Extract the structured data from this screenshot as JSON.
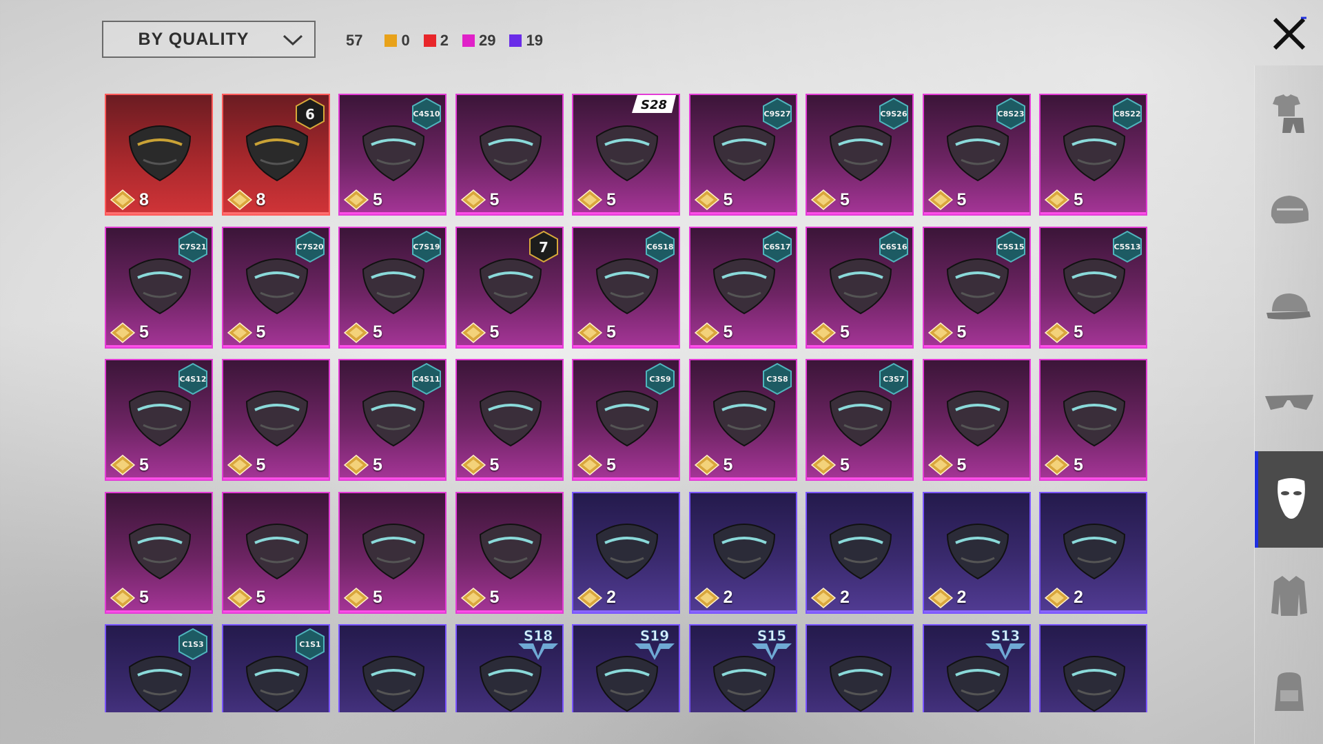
{
  "sort": {
    "label": "BY QUALITY"
  },
  "counts": {
    "total": "57",
    "items": [
      {
        "color": "#e8a21a",
        "value": "0"
      },
      {
        "color": "#e8262a",
        "value": "2"
      },
      {
        "color": "#e021c8",
        "value": "29"
      },
      {
        "color": "#6a2ce8",
        "value": "19"
      }
    ]
  },
  "sidebar": {
    "categories": [
      {
        "icon": "outfit-icon",
        "active": false
      },
      {
        "icon": "helmet-icon",
        "active": false
      },
      {
        "icon": "cap-icon",
        "active": false
      },
      {
        "icon": "glasses-icon",
        "active": false
      },
      {
        "icon": "mask-icon",
        "active": true
      },
      {
        "icon": "jacket-icon",
        "active": false
      },
      {
        "icon": "backpack-icon",
        "active": false
      }
    ]
  },
  "grid": {
    "items": [
      {
        "quality": "red",
        "points": "8",
        "art": "tactical-helmet-mask-icon",
        "badge": null
      },
      {
        "quality": "red",
        "points": "8",
        "art": "plague-doctor-mask-icon",
        "badge": {
          "type": "level",
          "text": "6"
        }
      },
      {
        "quality": "pink",
        "points": "5",
        "art": "green-half-mask-icon",
        "badge": {
          "type": "hex",
          "text": "C4S10"
        }
      },
      {
        "quality": "pink",
        "points": "5",
        "art": "cat-mask-icon",
        "badge": null
      },
      {
        "quality": "pink",
        "points": "5",
        "art": "black-ornament-mask-icon",
        "badge": {
          "type": "season",
          "text": "S28"
        }
      },
      {
        "quality": "pink",
        "points": "5",
        "art": "blue-respirator-icon",
        "badge": {
          "type": "hex",
          "text": "C9S27"
        }
      },
      {
        "quality": "pink",
        "points": "5",
        "art": "gold-hex-mask-icon",
        "badge": {
          "type": "hex",
          "text": "C9S26"
        }
      },
      {
        "quality": "pink",
        "points": "5",
        "art": "neon-wave-mask-icon",
        "badge": {
          "type": "hex",
          "text": "C8S23"
        }
      },
      {
        "quality": "pink",
        "points": "5",
        "art": "black-ring-mask-icon",
        "badge": {
          "type": "hex",
          "text": "C8S22"
        }
      },
      {
        "quality": "pink",
        "points": "5",
        "art": "mech-visor-mask-icon",
        "badge": {
          "type": "hex",
          "text": "C7S21"
        }
      },
      {
        "quality": "pink",
        "points": "5",
        "art": "cyan-fang-mask-icon",
        "badge": {
          "type": "hex",
          "text": "C7S20"
        }
      },
      {
        "quality": "pink",
        "points": "5",
        "art": "tribal-mask-icon",
        "badge": {
          "type": "hex",
          "text": "C7S19"
        }
      },
      {
        "quality": "pink",
        "points": "5",
        "art": "earpiece-icon",
        "badge": {
          "type": "level",
          "text": "7"
        }
      },
      {
        "quality": "pink",
        "points": "5",
        "art": "gold-jaw-mask-icon",
        "badge": {
          "type": "hex",
          "text": "C6S18"
        }
      },
      {
        "quality": "pink",
        "points": "5",
        "art": "graffiti-mask-icon",
        "badge": {
          "type": "hex",
          "text": "C6S17"
        }
      },
      {
        "quality": "pink",
        "points": "5",
        "art": "yellow-gasmask-icon",
        "badge": {
          "type": "hex",
          "text": "C6S16"
        }
      },
      {
        "quality": "pink",
        "points": "5",
        "art": "yellow-filter-mask-icon",
        "badge": {
          "type": "hex",
          "text": "C5S15"
        }
      },
      {
        "quality": "pink",
        "points": "5",
        "art": "signature-mask-icon",
        "badge": {
          "type": "hex",
          "text": "C5S13"
        }
      },
      {
        "quality": "pink",
        "points": "5",
        "art": "teeth-mask-icon",
        "badge": {
          "type": "hex",
          "text": "C4S12"
        }
      },
      {
        "quality": "pink",
        "points": "5",
        "art": "warrior-helm-icon",
        "badge": null
      },
      {
        "quality": "pink",
        "points": "5",
        "art": "dark-pink-mask-icon",
        "badge": {
          "type": "hex",
          "text": "C4S11"
        }
      },
      {
        "quality": "pink",
        "points": "5",
        "art": "fox-mask-icon",
        "badge": null
      },
      {
        "quality": "pink",
        "points": "5",
        "art": "pink-gasmask-icon",
        "badge": {
          "type": "hex",
          "text": "C3S9"
        }
      },
      {
        "quality": "pink",
        "points": "5",
        "art": "grey-respirator-icon",
        "badge": {
          "type": "hex",
          "text": "C3S8"
        }
      },
      {
        "quality": "pink",
        "points": "5",
        "art": "gold-veil-mask-icon",
        "badge": {
          "type": "hex",
          "text": "C3S7"
        }
      },
      {
        "quality": "pink",
        "points": "5",
        "art": "lion-dance-mask-icon",
        "badge": null
      },
      {
        "quality": "pink",
        "points": "5",
        "art": "robot-skull-icon",
        "badge": null
      },
      {
        "quality": "pink",
        "points": "5",
        "art": "skull-bandana-icon",
        "badge": null
      },
      {
        "quality": "pink",
        "points": "5",
        "art": "beak-mask-icon",
        "badge": null
      },
      {
        "quality": "pink",
        "points": "5",
        "art": "white-hood-icon",
        "badge": null
      },
      {
        "quality": "pink",
        "points": "5",
        "art": "black-bandana-icon",
        "badge": null
      },
      {
        "quality": "purple",
        "points": "2",
        "art": "black-cloth-mask-icon",
        "badge": null
      },
      {
        "quality": "purple",
        "points": "2",
        "art": "red-light-device-icon",
        "badge": null
      },
      {
        "quality": "purple",
        "points": "2",
        "art": "mammoth-mask-icon",
        "badge": null
      },
      {
        "quality": "purple",
        "points": "2",
        "art": "pink-dino-mask-icon",
        "badge": null
      },
      {
        "quality": "purple",
        "points": "2",
        "art": "grin-mask-icon",
        "badge": null
      },
      {
        "quality": "purple",
        "points": "",
        "art": "cactus-mask-icon",
        "badge": {
          "type": "hex",
          "text": "C1S3"
        }
      },
      {
        "quality": "purple",
        "points": "",
        "art": "blue-wave-mask-icon",
        "badge": {
          "type": "hex",
          "text": "C1S1"
        }
      },
      {
        "quality": "purple",
        "points": "",
        "art": "black-gasmask-icon",
        "badge": null
      },
      {
        "quality": "purple",
        "points": "",
        "art": "heartbeat-mask-icon",
        "badge": {
          "type": "wing",
          "text": "S18"
        }
      },
      {
        "quality": "purple",
        "points": "",
        "art": "ice-visor-icon",
        "badge": {
          "type": "wing",
          "text": "S19"
        }
      },
      {
        "quality": "purple",
        "points": "",
        "art": "samurai-skull-icon",
        "badge": {
          "type": "wing",
          "text": "S15"
        }
      },
      {
        "quality": "purple",
        "points": "",
        "art": "purple-goggles-mask-icon",
        "badge": null
      },
      {
        "quality": "purple",
        "points": "",
        "art": "aviator-goggles-icon",
        "badge": {
          "type": "wing",
          "text": "S13"
        }
      },
      {
        "quality": "purple",
        "points": "",
        "art": "silver-helmet-icon",
        "badge": null
      }
    ]
  }
}
